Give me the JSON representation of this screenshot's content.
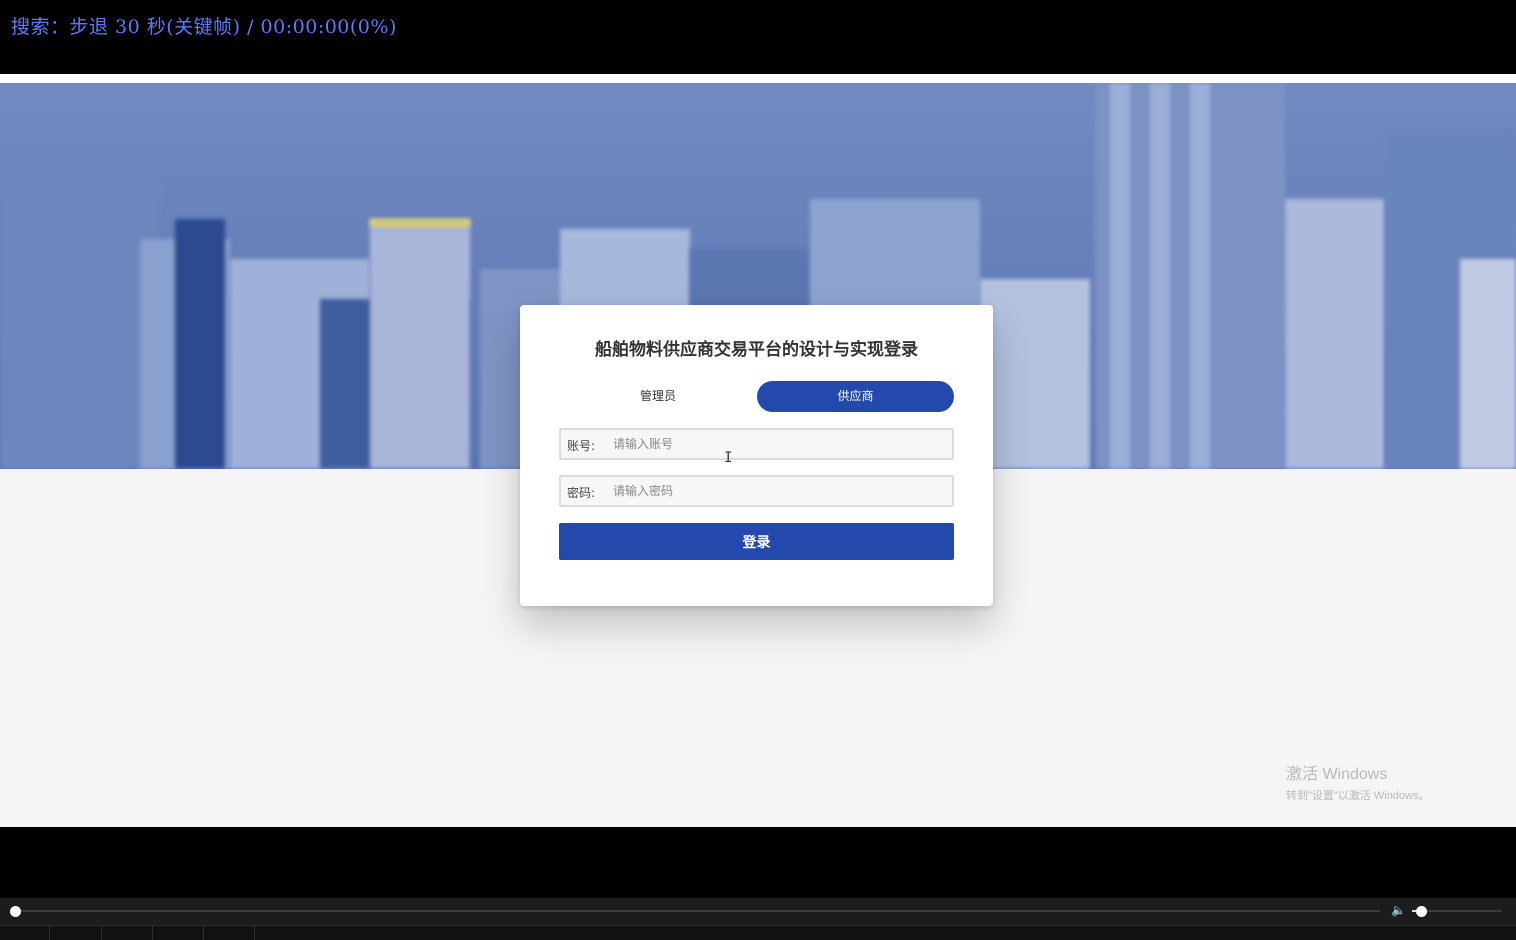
{
  "osd": {
    "text": "搜索：步退 30 秒(关键帧) / 00:00:00(0%)"
  },
  "page": {
    "title": "船舶物料供应商交易平台的设计与实现登录",
    "roles": {
      "admin": "管理员",
      "supplier": "供应商",
      "selected": "supplier"
    },
    "username": {
      "label": "账号:",
      "placeholder": "请输入账号",
      "value": ""
    },
    "password": {
      "label": "密码:",
      "placeholder": "请输入密码",
      "value": ""
    },
    "login_button": "登录",
    "accent_color": "#2249ab"
  },
  "watermark": {
    "title": "激活 Windows",
    "subtitle": "转到\"设置\"以激活 Windows。"
  },
  "player": {
    "progress_percent": 0,
    "volume_fraction": 0.1
  },
  "icons": {
    "cursor": "text-cursor-icon",
    "volume": "speaker-icon"
  }
}
